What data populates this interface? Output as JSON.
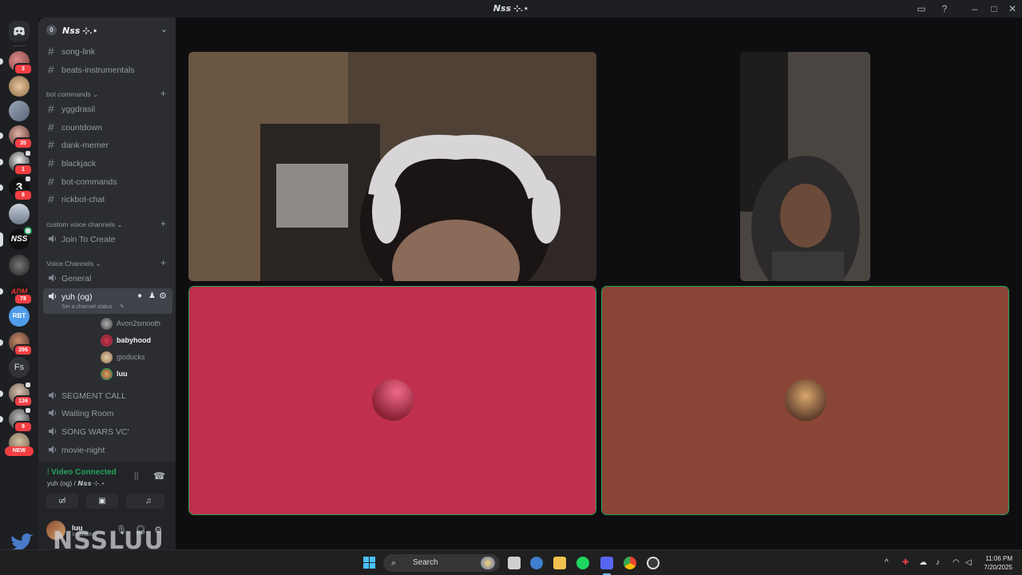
{
  "window": {
    "title": "𝙉𝙨𝙨 ⊹.⋆"
  },
  "servers": [
    {
      "name": "server-1",
      "badge": "3"
    },
    {
      "name": "server-2",
      "badge": ""
    },
    {
      "name": "server-3",
      "badge": ""
    },
    {
      "name": "server-4",
      "badge": "35"
    },
    {
      "name": "server-5",
      "badge": "1"
    },
    {
      "name": "server-6",
      "badge": "8"
    },
    {
      "name": "server-7",
      "badge": ""
    },
    {
      "name": "nss",
      "badge": ""
    },
    {
      "name": "server-9",
      "badge": ""
    },
    {
      "name": "adm",
      "badge": "78"
    },
    {
      "name": "rbt",
      "badge": ""
    },
    {
      "name": "server-12",
      "badge": "296"
    },
    {
      "name": "fs",
      "label": "Fs",
      "badge": ""
    },
    {
      "name": "server-14",
      "badge": "136"
    },
    {
      "name": "server-15",
      "badge": "9"
    },
    {
      "name": "server-16",
      "badge": "NEW"
    }
  ],
  "sidebar": {
    "server_name": "𝙉𝙨𝙨 ⊹.⋆",
    "boost_level": "0",
    "top_channels": [
      "song-link",
      "beats-instrumentals"
    ],
    "bot_category": "bot commands",
    "bot_channels": [
      "yggdrasil",
      "countdown",
      "dank-memer",
      "blackjack",
      "bot-commands",
      "rickbot-chat"
    ],
    "custom_category": "custom voice channels",
    "custom_channels": [
      "Join To Create"
    ],
    "voice_category": "Voice Channels",
    "voice_general": "General",
    "active_voice": {
      "name": "yuh (og)",
      "status_placeholder": "Set a channel status",
      "users": [
        {
          "name": "Avon2smooth",
          "bold": false,
          "camera": true
        },
        {
          "name": "babyhood",
          "bold": true,
          "camera": false
        },
        {
          "name": "gioducks",
          "bold": false,
          "camera": true
        },
        {
          "name": "luu",
          "bold": true,
          "camera": false
        }
      ]
    },
    "more_voice": [
      "SEGMENT CALL",
      "Waiting Room",
      "SONG WARS VC'",
      "movie-night"
    ]
  },
  "voice_panel": {
    "status": "Video Connected",
    "location": "yuh (og) / 𝙉𝙨𝙨 ⊹.⋆"
  },
  "user_panel": {
    "name": "luu",
    "status": "Invisible",
    "watermark": "NSSLUU"
  },
  "colors": {
    "tile_red": "#c0304e",
    "tile_brown": "#8b4536",
    "speaking": "#23a55a"
  },
  "taskbar": {
    "search_label": "Search",
    "time": "11:06 PM",
    "date": "7/20/2025"
  }
}
